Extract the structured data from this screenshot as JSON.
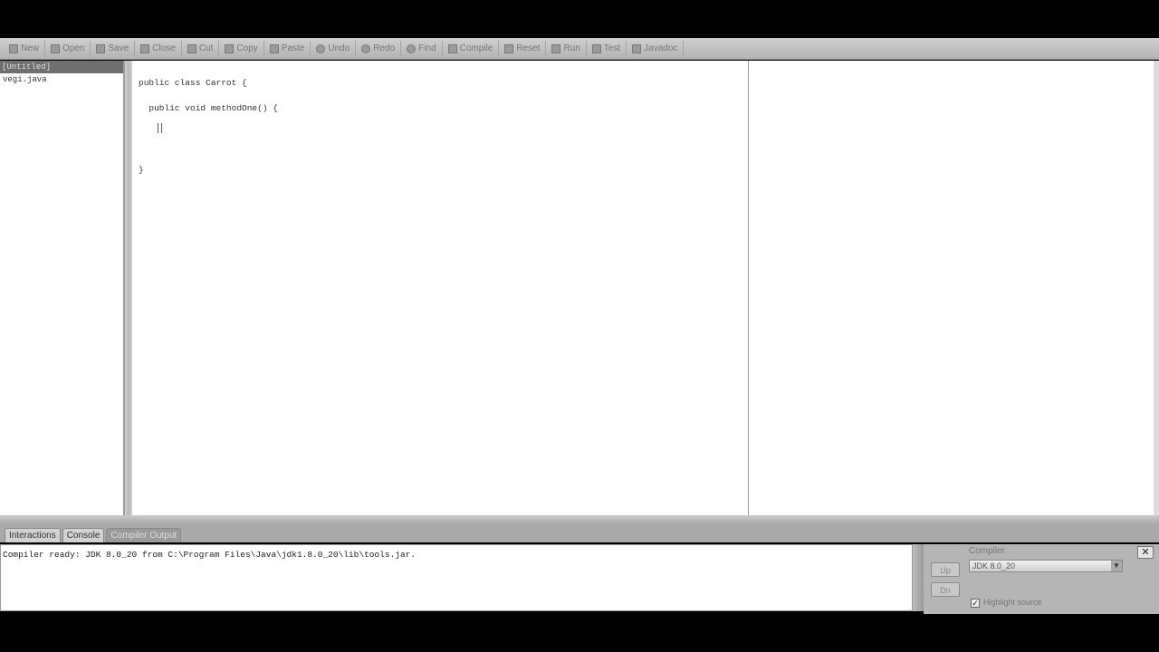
{
  "toolbar": {
    "buttons": [
      {
        "label": "New",
        "icon": "new-file-icon"
      },
      {
        "label": "Open",
        "icon": "open-folder-icon"
      },
      {
        "label": "Save",
        "icon": "save-icon"
      },
      {
        "label": "Close",
        "icon": "close-file-icon"
      },
      {
        "label": "Cut",
        "icon": "cut-icon"
      },
      {
        "label": "Copy",
        "icon": "copy-icon"
      },
      {
        "label": "Paste",
        "icon": "paste-icon"
      },
      {
        "label": "Undo",
        "icon": "undo-icon"
      },
      {
        "label": "Redo",
        "icon": "redo-icon"
      },
      {
        "label": "Find",
        "icon": "find-icon"
      },
      {
        "label": "Compile",
        "icon": "compile-icon"
      },
      {
        "label": "Reset",
        "icon": "reset-icon"
      },
      {
        "label": "Run",
        "icon": "run-icon"
      },
      {
        "label": "Test",
        "icon": "test-icon"
      },
      {
        "label": "Javadoc",
        "icon": "javadoc-icon"
      }
    ]
  },
  "documents": {
    "header": "[Untitled]",
    "items": [
      "vegi.java"
    ]
  },
  "editor": {
    "lines": [
      "public class Carrot {",
      "  public void methodOne() {",
      "}"
    ]
  },
  "tabs": [
    {
      "label": "Interactions",
      "active": false
    },
    {
      "label": "Console",
      "active": false
    },
    {
      "label": "Compiler Output",
      "active": true
    }
  ],
  "output": {
    "text": "Compiler ready: JDK 8.0_20 from C:\\Program Files\\Java\\jdk1.8.0_20\\lib\\tools.jar."
  },
  "compiler_panel": {
    "label": "Compiler",
    "selected": "JDK 8.0_20",
    "highlight_source_label": "Highlight source",
    "highlight_source_checked": true,
    "up_button": "Up",
    "down_button": "Dn",
    "close_glyph": "✕"
  },
  "colors": {
    "toolbar": "#bdbdbd",
    "active_tab": "#9a9a9a",
    "editor_bg": "#ffffff"
  }
}
